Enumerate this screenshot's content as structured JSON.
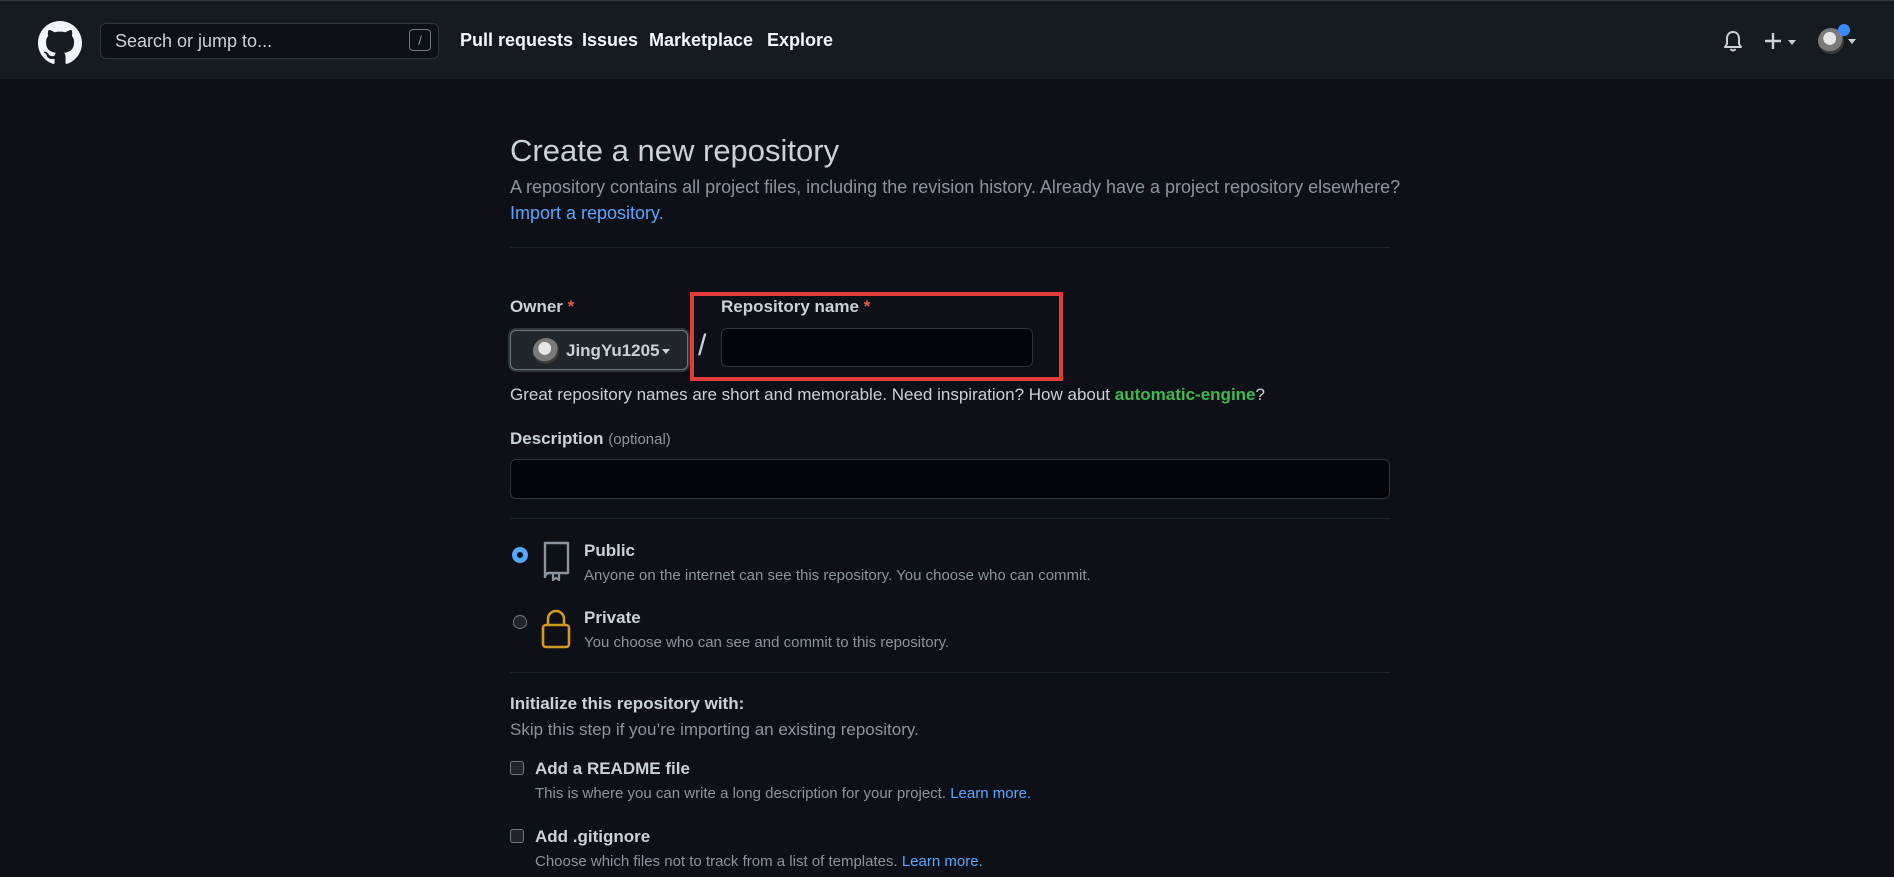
{
  "header": {
    "search_placeholder": "Search or jump to...",
    "search_shortcut": "/",
    "nav": [
      "Pull requests",
      "Issues",
      "Marketplace",
      "Explore"
    ]
  },
  "page": {
    "title": "Create a new repository",
    "lead": "A repository contains all project files, including the revision history. Already have a project repository elsewhere?",
    "import_link": "Import a repository."
  },
  "owner": {
    "label": "Owner",
    "required_mark": "*",
    "value": "JingYu1205"
  },
  "separator": "/",
  "repo_name": {
    "label": "Repository name",
    "required_mark": "*",
    "value": ""
  },
  "hint": {
    "text": "Great repository names are short and memorable. Need inspiration? How about ",
    "suggestion": "automatic-engine",
    "end": "?"
  },
  "description": {
    "label": "Description",
    "optional": "(optional)",
    "value": ""
  },
  "visibility": [
    {
      "title": "Public",
      "desc": "Anyone on the internet can see this repository. You choose who can commit.",
      "selected": true
    },
    {
      "title": "Private",
      "desc": "You choose who can see and commit to this repository.",
      "selected": false
    }
  ],
  "init": {
    "title": "Initialize this repository with:",
    "desc": "Skip this step if you’re importing an existing repository.",
    "options": [
      {
        "title": "Add a README file",
        "desc": "This is where you can write a long description for your project.",
        "link": "Learn more."
      },
      {
        "title": "Add .gitignore",
        "desc": "Choose which files not to track from a list of templates.",
        "link": "Learn more."
      }
    ]
  },
  "colors": {
    "background": "#0d1117",
    "header": "#161b22",
    "link": "#58a6ff",
    "required": "#f85149",
    "suggestion": "#3fb950",
    "highlight": "#e23b3b",
    "private_icon": "#d29922"
  }
}
